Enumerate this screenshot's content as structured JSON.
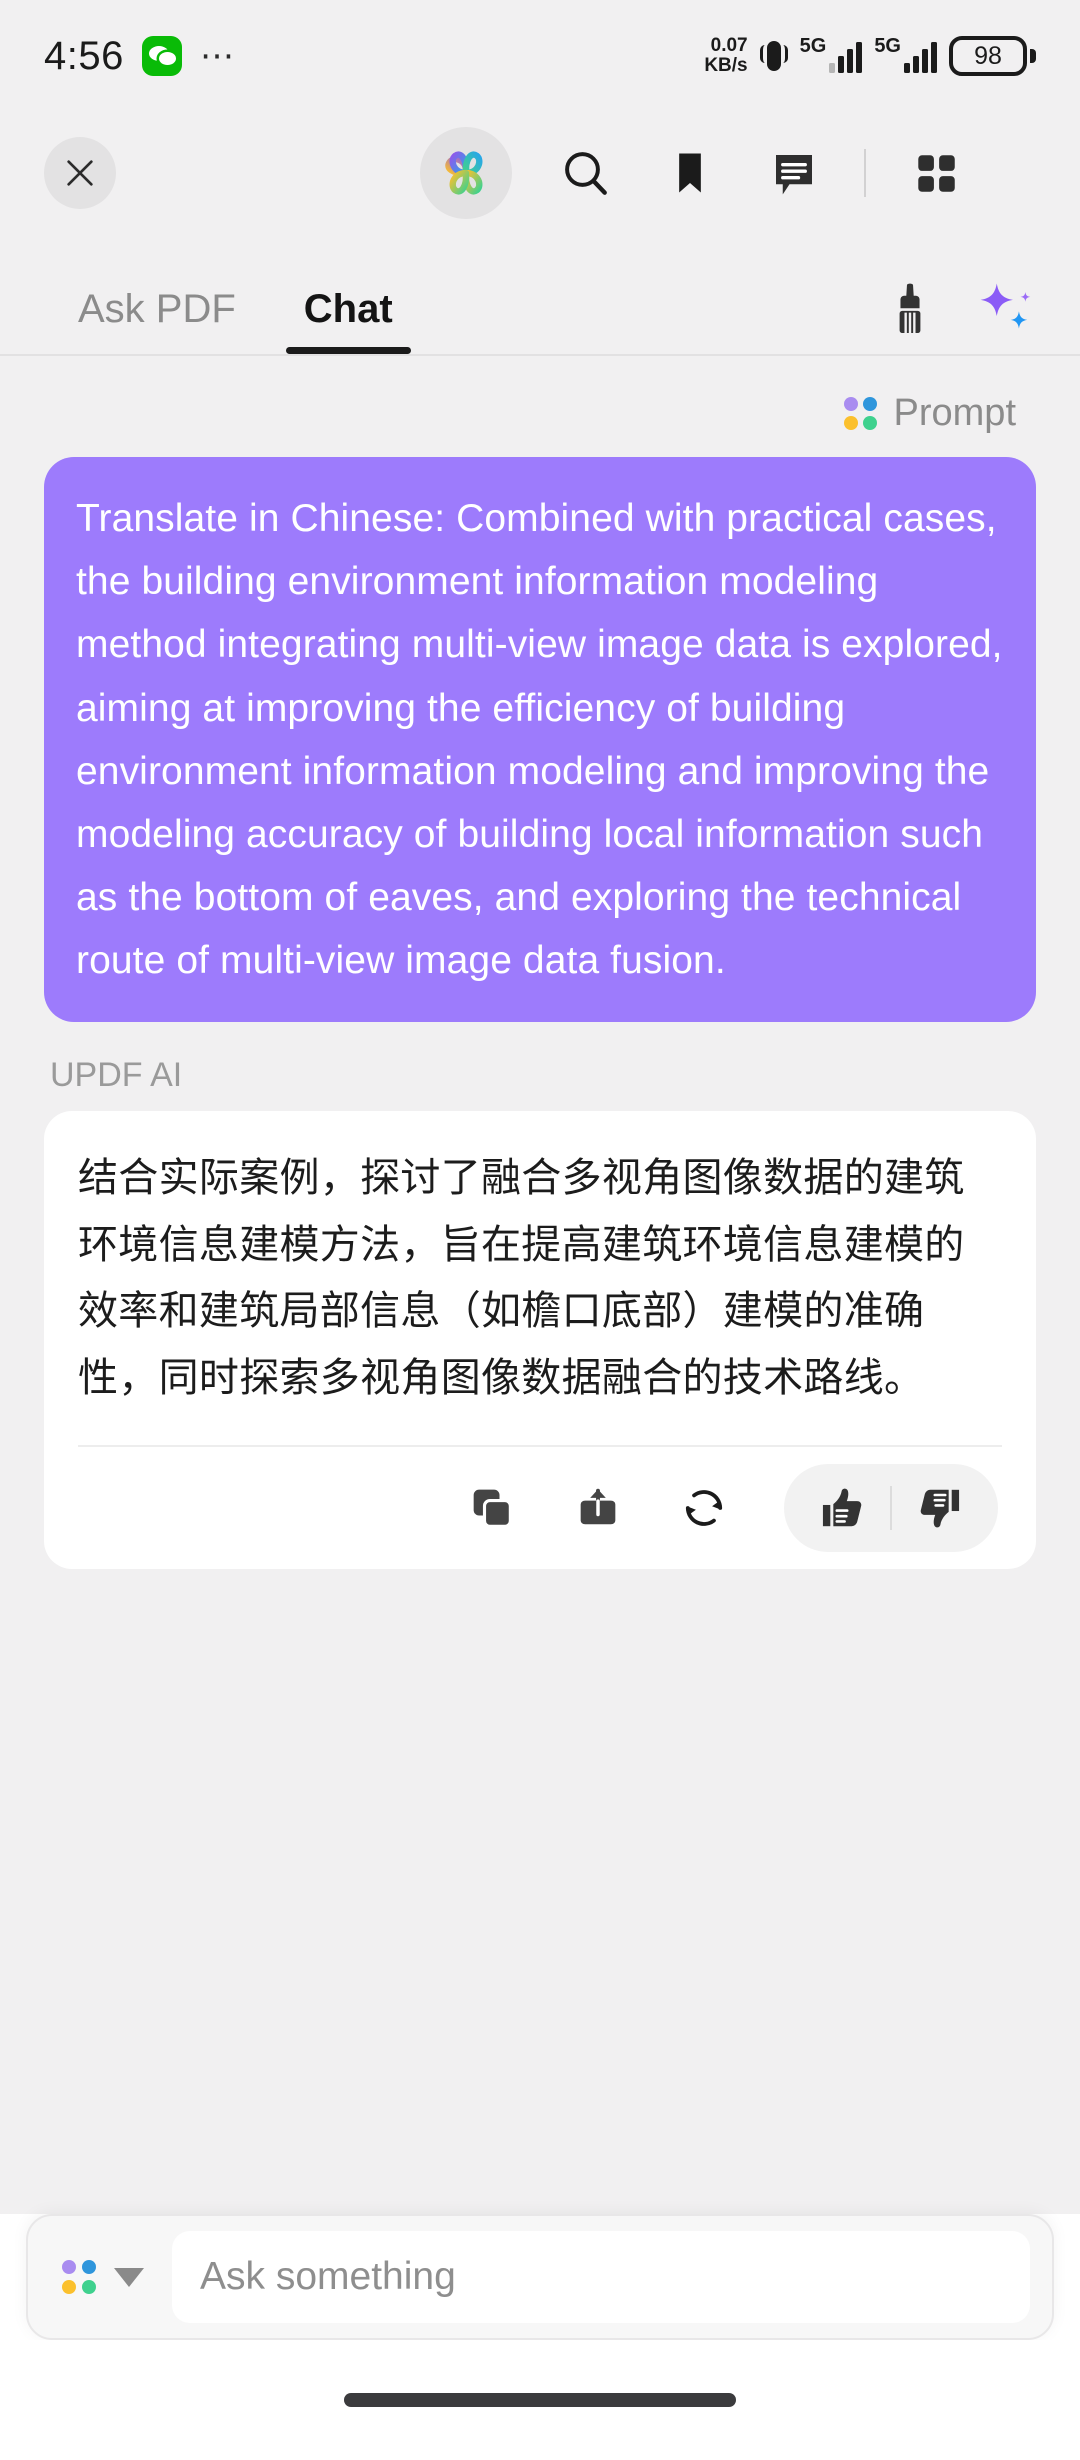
{
  "status_bar": {
    "time": "4:56",
    "app_icon": "wechat-icon",
    "overflow": "⋯",
    "net_speed_value": "0.07",
    "net_speed_unit": "KB/s",
    "vibrate_icon": "vibrate-icon",
    "sim1_network": "5G",
    "sim2_network": "5G",
    "battery_percent": "98"
  },
  "toolbar": {
    "close_label": "✕",
    "ai_logo_name": "updf-ai-clover-logo",
    "search_label": "search-icon",
    "bookmark_label": "bookmark-icon",
    "comment_label": "annotation-icon",
    "grid_label": "page-grid-icon"
  },
  "tabs": [
    {
      "label": "Ask PDF",
      "active": false
    },
    {
      "label": "Chat",
      "active": true
    }
  ],
  "tab_actions": {
    "clear_label": "brush-clear-icon",
    "sparkle_label": "ai-sparkle-icon"
  },
  "conversation": {
    "prompt_label": "Prompt",
    "user_message": "Translate in Chinese: Combined with practical cases, the building environment information modeling method integrating multi-view image data is explored, aiming at improving the efficiency of building environment information modeling and improving the modeling accuracy of building local information such as the bottom of eaves, and exploring the technical route of multi-view image data fusion.",
    "assistant_name": "UPDF AI",
    "assistant_message": "结合实际案例，探讨了融合多视角图像数据的建筑环境信息建模方法，旨在提高建筑环境信息建模的效率和建筑局部信息（如檐口底部）建模的准确性，同时探索多视角图像数据融合的技术路线。",
    "actions": {
      "copy": "copy-icon",
      "export": "export-icon",
      "regenerate": "regenerate-icon",
      "like": "thumbs-up-icon",
      "dislike": "thumbs-down-icon"
    }
  },
  "composer": {
    "model_picker": "model-dots-icon",
    "caret": "chevron-down-icon",
    "placeholder": "Ask something",
    "value": ""
  },
  "colors": {
    "accent_purple": "#9D7BFC",
    "page_bg": "#F1F0F1",
    "card_bg": "#FFFFFF",
    "muted_text": "#8B8B8B",
    "dot_purple": "#A98CF0",
    "dot_blue": "#2F96DC",
    "dot_yellow": "#FBC02D",
    "dot_green": "#3FD18E"
  }
}
